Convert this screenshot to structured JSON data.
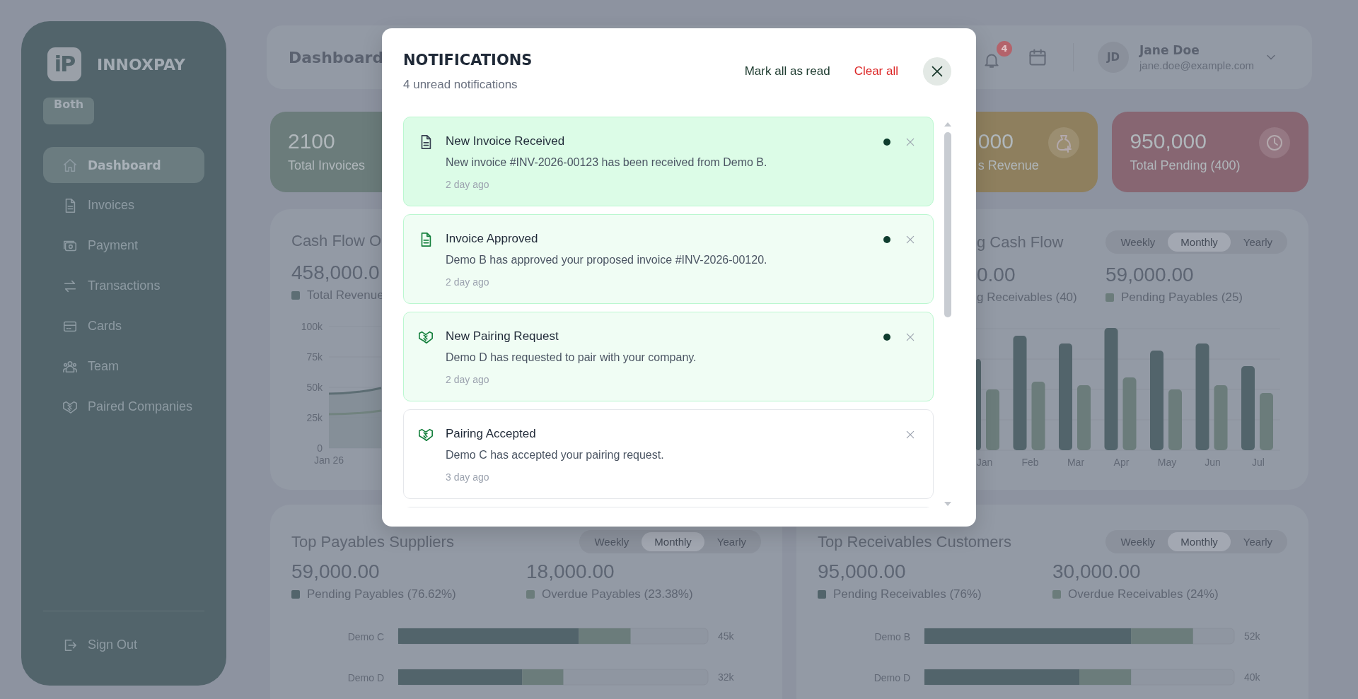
{
  "sidebar": {
    "logo": "iP",
    "brand": "INNOXPAY",
    "mode_badge": "Both",
    "items": [
      {
        "label": "Dashboard",
        "selected": true
      },
      {
        "label": "Invoices",
        "selected": false
      },
      {
        "label": "Payment",
        "selected": false
      },
      {
        "label": "Transactions",
        "selected": false
      },
      {
        "label": "Cards",
        "selected": false
      },
      {
        "label": "Team",
        "selected": false
      },
      {
        "label": "Paired Companies",
        "selected": false
      }
    ],
    "footer": {
      "label": "Sign Out"
    }
  },
  "header": {
    "title": "Dashboard",
    "notification_count": "4",
    "user": {
      "initials": "JD",
      "name": "Jane Doe",
      "email": "jane.doe@example.com"
    }
  },
  "stat_cards": [
    {
      "kind": "invoices",
      "value": "2100",
      "label": "Total Invoices",
      "color": "#6b7c7b"
    },
    {
      "kind": "revenue",
      "value": "000",
      "label": "s Revenue",
      "color": "#8e7f5e"
    },
    {
      "kind": "pending",
      "value": "950,000",
      "label": "Total Pending (400)",
      "color": "#876672"
    }
  ],
  "cash_flow": {
    "title": "Cash Flow O",
    "value": "458,000.0",
    "legend": "Total Revenue",
    "y_labels": [
      "100k",
      "75k",
      "50k",
      "25k",
      "0"
    ],
    "x_labels": [
      "Jan 26"
    ]
  },
  "upcoming": {
    "title": "g Cash Flow",
    "periods": [
      {
        "label": "Weekly",
        "selected": false
      },
      {
        "label": "Monthly",
        "selected": true
      },
      {
        "label": "Yearly",
        "selected": false
      }
    ],
    "stats": [
      {
        "value": "0.00",
        "label": "g Receivables (40)"
      },
      {
        "value": "59,000.00",
        "label": "Pending Payables (25)",
        "color": "#6b7c7b"
      }
    ],
    "months": [
      "Jan",
      "Feb",
      "Mar",
      "Apr",
      "May",
      "Jun",
      "Jul"
    ]
  },
  "bottom_panels": [
    {
      "title": "Top Payables Suppliers",
      "periods": [
        {
          "label": "Weekly",
          "selected": false
        },
        {
          "label": "Monthly",
          "selected": true
        },
        {
          "label": "Yearly",
          "selected": false
        }
      ],
      "stats": [
        {
          "value": "59,000.00",
          "label": "Pending Payables (76.62%)",
          "color": "#52646b"
        },
        {
          "value": "18,000.00",
          "label": "Overdue Payables (23.38%)",
          "color": "#6b7c7b"
        }
      ],
      "rows": [
        {
          "label": "Demo C",
          "total": "45k"
        },
        {
          "label": "Demo D",
          "total": "32k"
        }
      ]
    },
    {
      "title": "Top Receivables Customers",
      "periods": [
        {
          "label": "Weekly",
          "selected": false
        },
        {
          "label": "Monthly",
          "selected": true
        },
        {
          "label": "Yearly",
          "selected": false
        }
      ],
      "stats": [
        {
          "value": "95,000.00",
          "label": "Pending Receivables (76%)",
          "color": "#52646b"
        },
        {
          "value": "30,000.00",
          "label": "Overdue Receivables (24%)",
          "color": "#6b7c7b"
        }
      ],
      "rows": [
        {
          "label": "Demo B",
          "total": "52k"
        },
        {
          "label": "Demo D",
          "total": "40k"
        }
      ]
    }
  ],
  "modal": {
    "title": "NOTIFICATIONS",
    "subtitle": "4 unread notifications",
    "mark_all": "Mark all as read",
    "clear_all": "Clear all",
    "items": [
      {
        "kind": "invoice",
        "title": "New Invoice Received",
        "message": "New invoice #INV-2026-00123 has been received from Demo B.",
        "time": "2 day ago",
        "read": false,
        "selected": true
      },
      {
        "kind": "invoice",
        "title": "Invoice Approved",
        "message": "Demo B has approved your proposed invoice #INV-2026-00120.",
        "time": "2 day ago",
        "read": false,
        "selected": false
      },
      {
        "kind": "pairing",
        "title": "New Pairing Request",
        "message": "Demo D has requested to pair with your company.",
        "time": "2 day ago",
        "read": false,
        "selected": false
      },
      {
        "kind": "pairing",
        "title": "Pairing Accepted",
        "message": "Demo C has accepted your pairing request.",
        "time": "3 day ago",
        "read": true,
        "selected": false
      }
    ]
  }
}
